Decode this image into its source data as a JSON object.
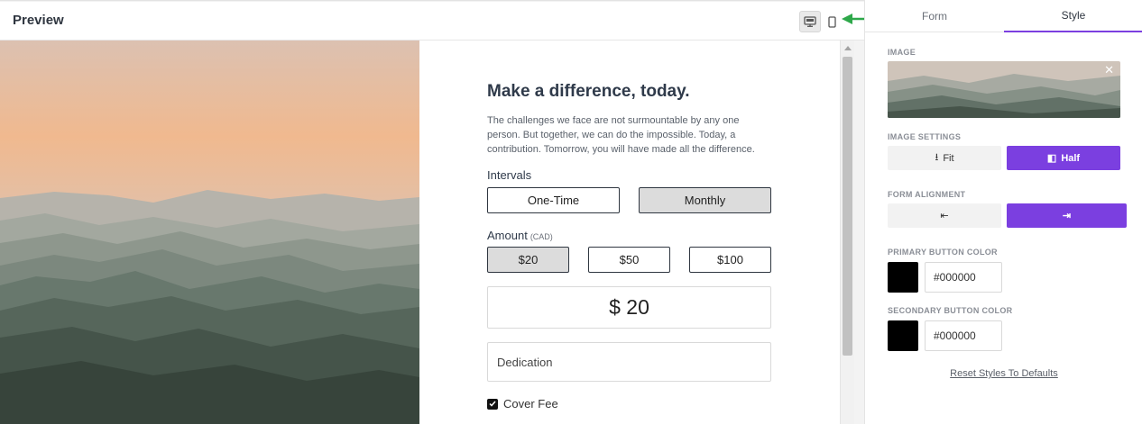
{
  "preview": {
    "title": "Preview"
  },
  "form": {
    "heading": "Make a difference, today.",
    "description": "The challenges we face are not surmountable by any one person. But together, we can do the impossible. Today, a contribution. Tomorrow, you will have made all the difference.",
    "intervals_label": "Intervals",
    "intervals": [
      {
        "label": "One-Time",
        "selected": false
      },
      {
        "label": "Monthly",
        "selected": true
      }
    ],
    "amount_label": "Amount",
    "amount_currency": "(CAD)",
    "amounts": [
      {
        "label": "$20",
        "selected": true
      },
      {
        "label": "$50",
        "selected": false
      },
      {
        "label": "$100",
        "selected": false
      }
    ],
    "amount_value": "$ 20",
    "dedication_placeholder": "Dedication",
    "cover_fee_label": "Cover Fee",
    "cover_fee_checked": true
  },
  "sidebar": {
    "tabs": [
      {
        "label": "Form",
        "active": false
      },
      {
        "label": "Style",
        "active": true
      }
    ],
    "image_label": "IMAGE",
    "image_settings_label": "IMAGE SETTINGS",
    "image_settings": [
      {
        "label": "Fit",
        "selected": false,
        "icon": "fit-vertical-icon"
      },
      {
        "label": "Half",
        "selected": true,
        "icon": "half-panel-icon"
      }
    ],
    "form_alignment_label": "FORM ALIGNMENT",
    "form_alignment": [
      {
        "icon": "align-left-icon",
        "selected": false
      },
      {
        "icon": "align-right-icon",
        "selected": true
      }
    ],
    "primary_button_color_label": "PRIMARY BUTTON COLOR",
    "primary_button_color": "#000000",
    "secondary_button_color_label": "SECONDARY BUTTON COLOR",
    "secondary_button_color": "#000000",
    "reset_label": "Reset Styles To Defaults"
  },
  "colors": {
    "accent": "#7b3fe0",
    "arrow": "#2ea84a"
  }
}
